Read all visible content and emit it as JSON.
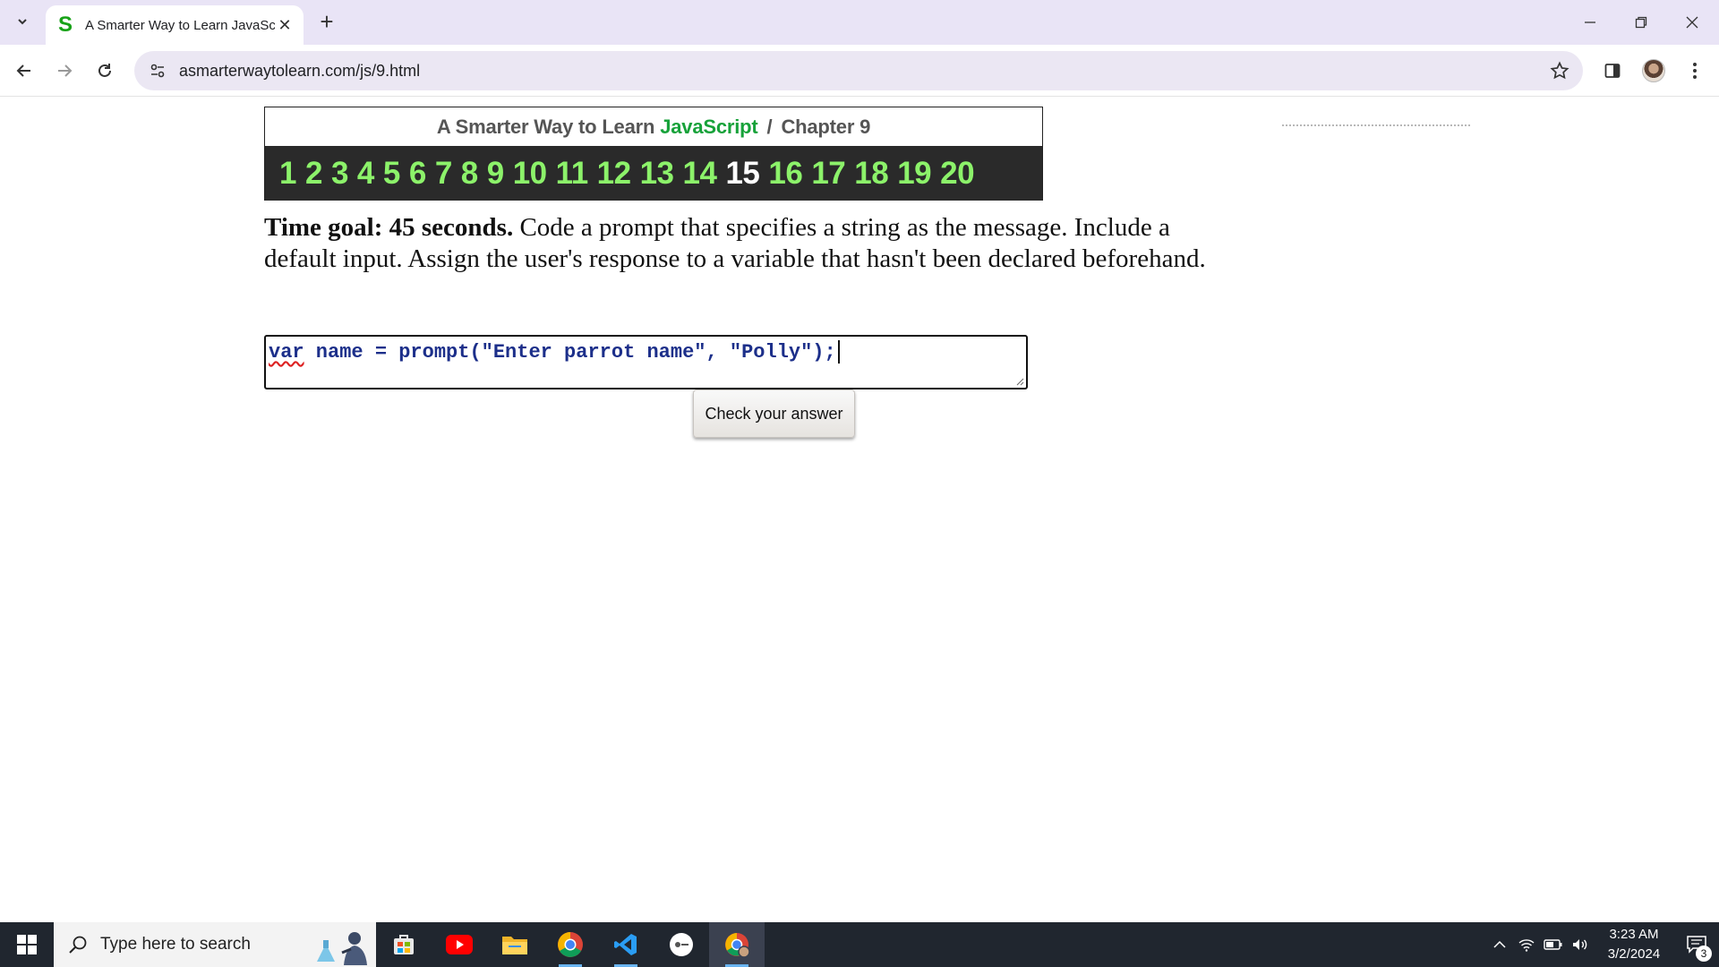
{
  "browser": {
    "tab_title": "A Smarter Way to Learn JavaScript",
    "tab_favicon_letter": "S",
    "url": "asmarterwaytolearn.com/js/9.html"
  },
  "page": {
    "header": {
      "prefix": "A Smarter Way to Learn",
      "brand": "JavaScript",
      "separator": "/",
      "chapter": "Chapter 9"
    },
    "chapters": [
      "1",
      "2",
      "3",
      "4",
      "5",
      "6",
      "7",
      "8",
      "9",
      "10",
      "11",
      "12",
      "13",
      "14",
      "15",
      "16",
      "17",
      "18",
      "19",
      "20"
    ],
    "current_chapter": "15",
    "instructions": {
      "time_goal_label": "Time goal: 45 seconds.",
      "text": "Code a prompt that specifies a string as the message. Include a default input. Assign the user's response to a variable that hasn't been declared beforehand."
    },
    "code": {
      "keyword": "var",
      "rest": " name = prompt(\"Enter parrot name\", \"Polly\");"
    },
    "check_button": "Check your answer"
  },
  "taskbar": {
    "search_placeholder": "Type here to search",
    "time": "3:23 AM",
    "date": "3/2/2024",
    "notification_count": "3"
  },
  "colors": {
    "brand_green": "#17a23a",
    "chapter_link": "#8cf26a",
    "code_text": "#1c2f8a",
    "tabstrip_bg": "#e9e4f6",
    "taskbar_bg": "#20262f"
  }
}
